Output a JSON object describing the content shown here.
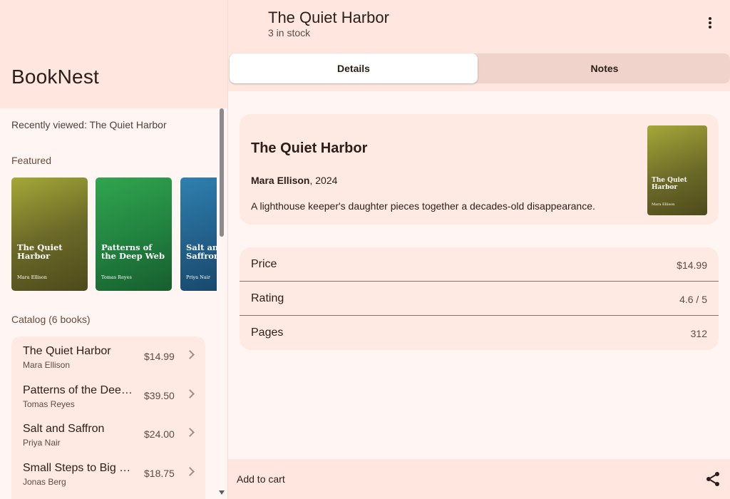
{
  "app": {
    "title": "BookNest"
  },
  "sidebar": {
    "recently_viewed": "Recently viewed: The Quiet Harbor",
    "featured_label": "Featured",
    "featured": [
      {
        "title": "The Quiet Harbor",
        "author": "Mara Ellison",
        "color": "#8a8a30"
      },
      {
        "title": "Patterns of the Deep Web",
        "author": "Tomas Reyes",
        "color": "#2a9446"
      },
      {
        "title": "Salt and Saffron",
        "author": "Priya Nair",
        "color": "#27709c"
      }
    ],
    "catalog_label": "Catalog (6 books)",
    "catalog": [
      {
        "title": "The Quiet Harbor",
        "author": "Mara Ellison",
        "price": "$14.99"
      },
      {
        "title": "Patterns of the Deep Web",
        "author": "Tomas Reyes",
        "price": "$39.50"
      },
      {
        "title": "Salt and Saffron",
        "author": "Priya Nair",
        "price": "$24.00"
      },
      {
        "title": "Small Steps to Big Savings",
        "author": "Jonas Berg",
        "price": "$18.75"
      }
    ]
  },
  "header": {
    "title": "The Quiet Harbor",
    "subtitle": "3 in stock"
  },
  "tabs": [
    {
      "label": "Details",
      "selected": true
    },
    {
      "label": "Notes",
      "selected": false
    }
  ],
  "detail": {
    "title": "The Quiet Harbor",
    "author": "Mara Ellison",
    "year": ", 2024",
    "synopsis": "A lighthouse keeper's daughter pieces together a decades-old disappearance.",
    "cover_title": "The Quiet Harbor",
    "cover_author": "Mara Ellison"
  },
  "specs": [
    {
      "label": "Price",
      "value": "$14.99"
    },
    {
      "label": "Rating",
      "value": "4.6 / 5"
    },
    {
      "label": "Pages",
      "value": "312"
    }
  ],
  "bottom": {
    "add_to_cart": "Add to cart"
  },
  "colors": {
    "accent_surface": "#ffe7df",
    "tab_selected": "#ffffff",
    "tab_track": "#f0d3ca"
  }
}
